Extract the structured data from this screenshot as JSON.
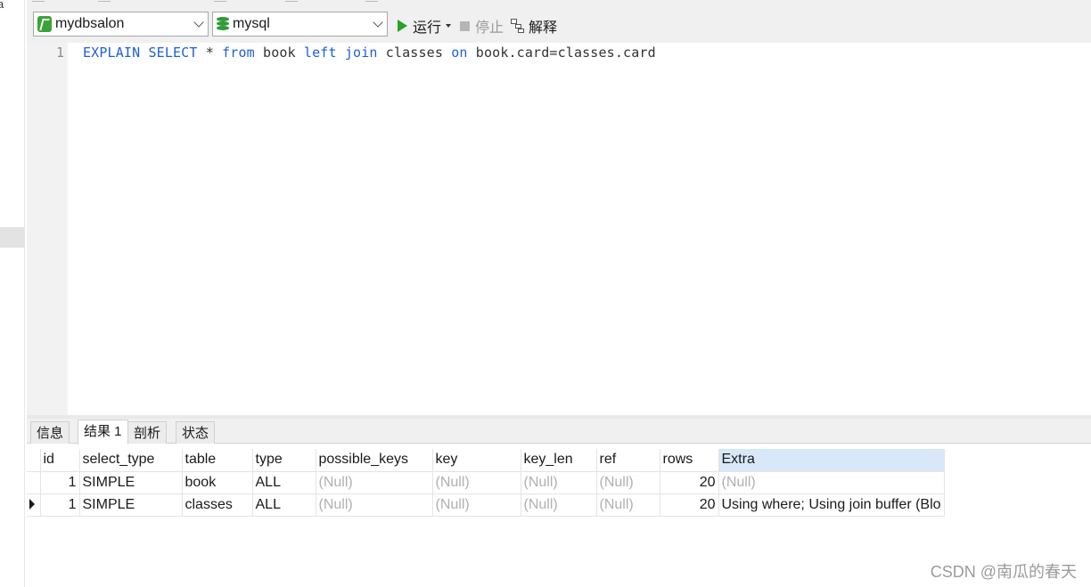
{
  "toolbar": {
    "connection": "mydbsalon",
    "database": "mysql",
    "run_label": "运行",
    "stop_label": "停止",
    "explain_label": "解释"
  },
  "editor": {
    "line_number": "1",
    "tokens": [
      {
        "text": "EXPLAIN",
        "kw": true
      },
      {
        "text": " ",
        "kw": false
      },
      {
        "text": "SELECT",
        "kw": true
      },
      {
        "text": " * ",
        "kw": false
      },
      {
        "text": "from",
        "kw": true
      },
      {
        "text": " book ",
        "kw": false
      },
      {
        "text": "left",
        "kw": true
      },
      {
        "text": " ",
        "kw": false
      },
      {
        "text": "join",
        "kw": true
      },
      {
        "text": " classes ",
        "kw": false
      },
      {
        "text": "on",
        "kw": true
      },
      {
        "text": " book.card=classes.card",
        "kw": false
      }
    ]
  },
  "left_panel": {
    "cut_char": "a"
  },
  "tabs": [
    "信息",
    "结果 1",
    "剖析",
    "状态"
  ],
  "active_tab": 1,
  "result": {
    "columns": [
      "id",
      "select_type",
      "table",
      "type",
      "possible_keys",
      "key",
      "key_len",
      "ref",
      "rows",
      "Extra"
    ],
    "rows": [
      [
        "1",
        "SIMPLE",
        "book",
        "ALL",
        "(Null)",
        "(Null)",
        "(Null)",
        "(Null)",
        "20",
        "(Null)"
      ],
      [
        "1",
        "SIMPLE",
        "classes",
        "ALL",
        "(Null)",
        "(Null)",
        "(Null)",
        "(Null)",
        "20",
        "Using where; Using join buffer (Blo"
      ]
    ],
    "selected_row": 1
  },
  "watermark": "CSDN @南瓜的春天",
  "colors": {
    "keyword": "#1f5fd9",
    "run_icon": "#29a329",
    "extra_header": "#d9e8f8",
    "null_text": "#b0b0b0"
  },
  "icons": {
    "connection": "mysql-connection-icon",
    "database": "database-icon",
    "run": "play-icon",
    "stop": "stop-icon",
    "explain": "explain-icon"
  }
}
